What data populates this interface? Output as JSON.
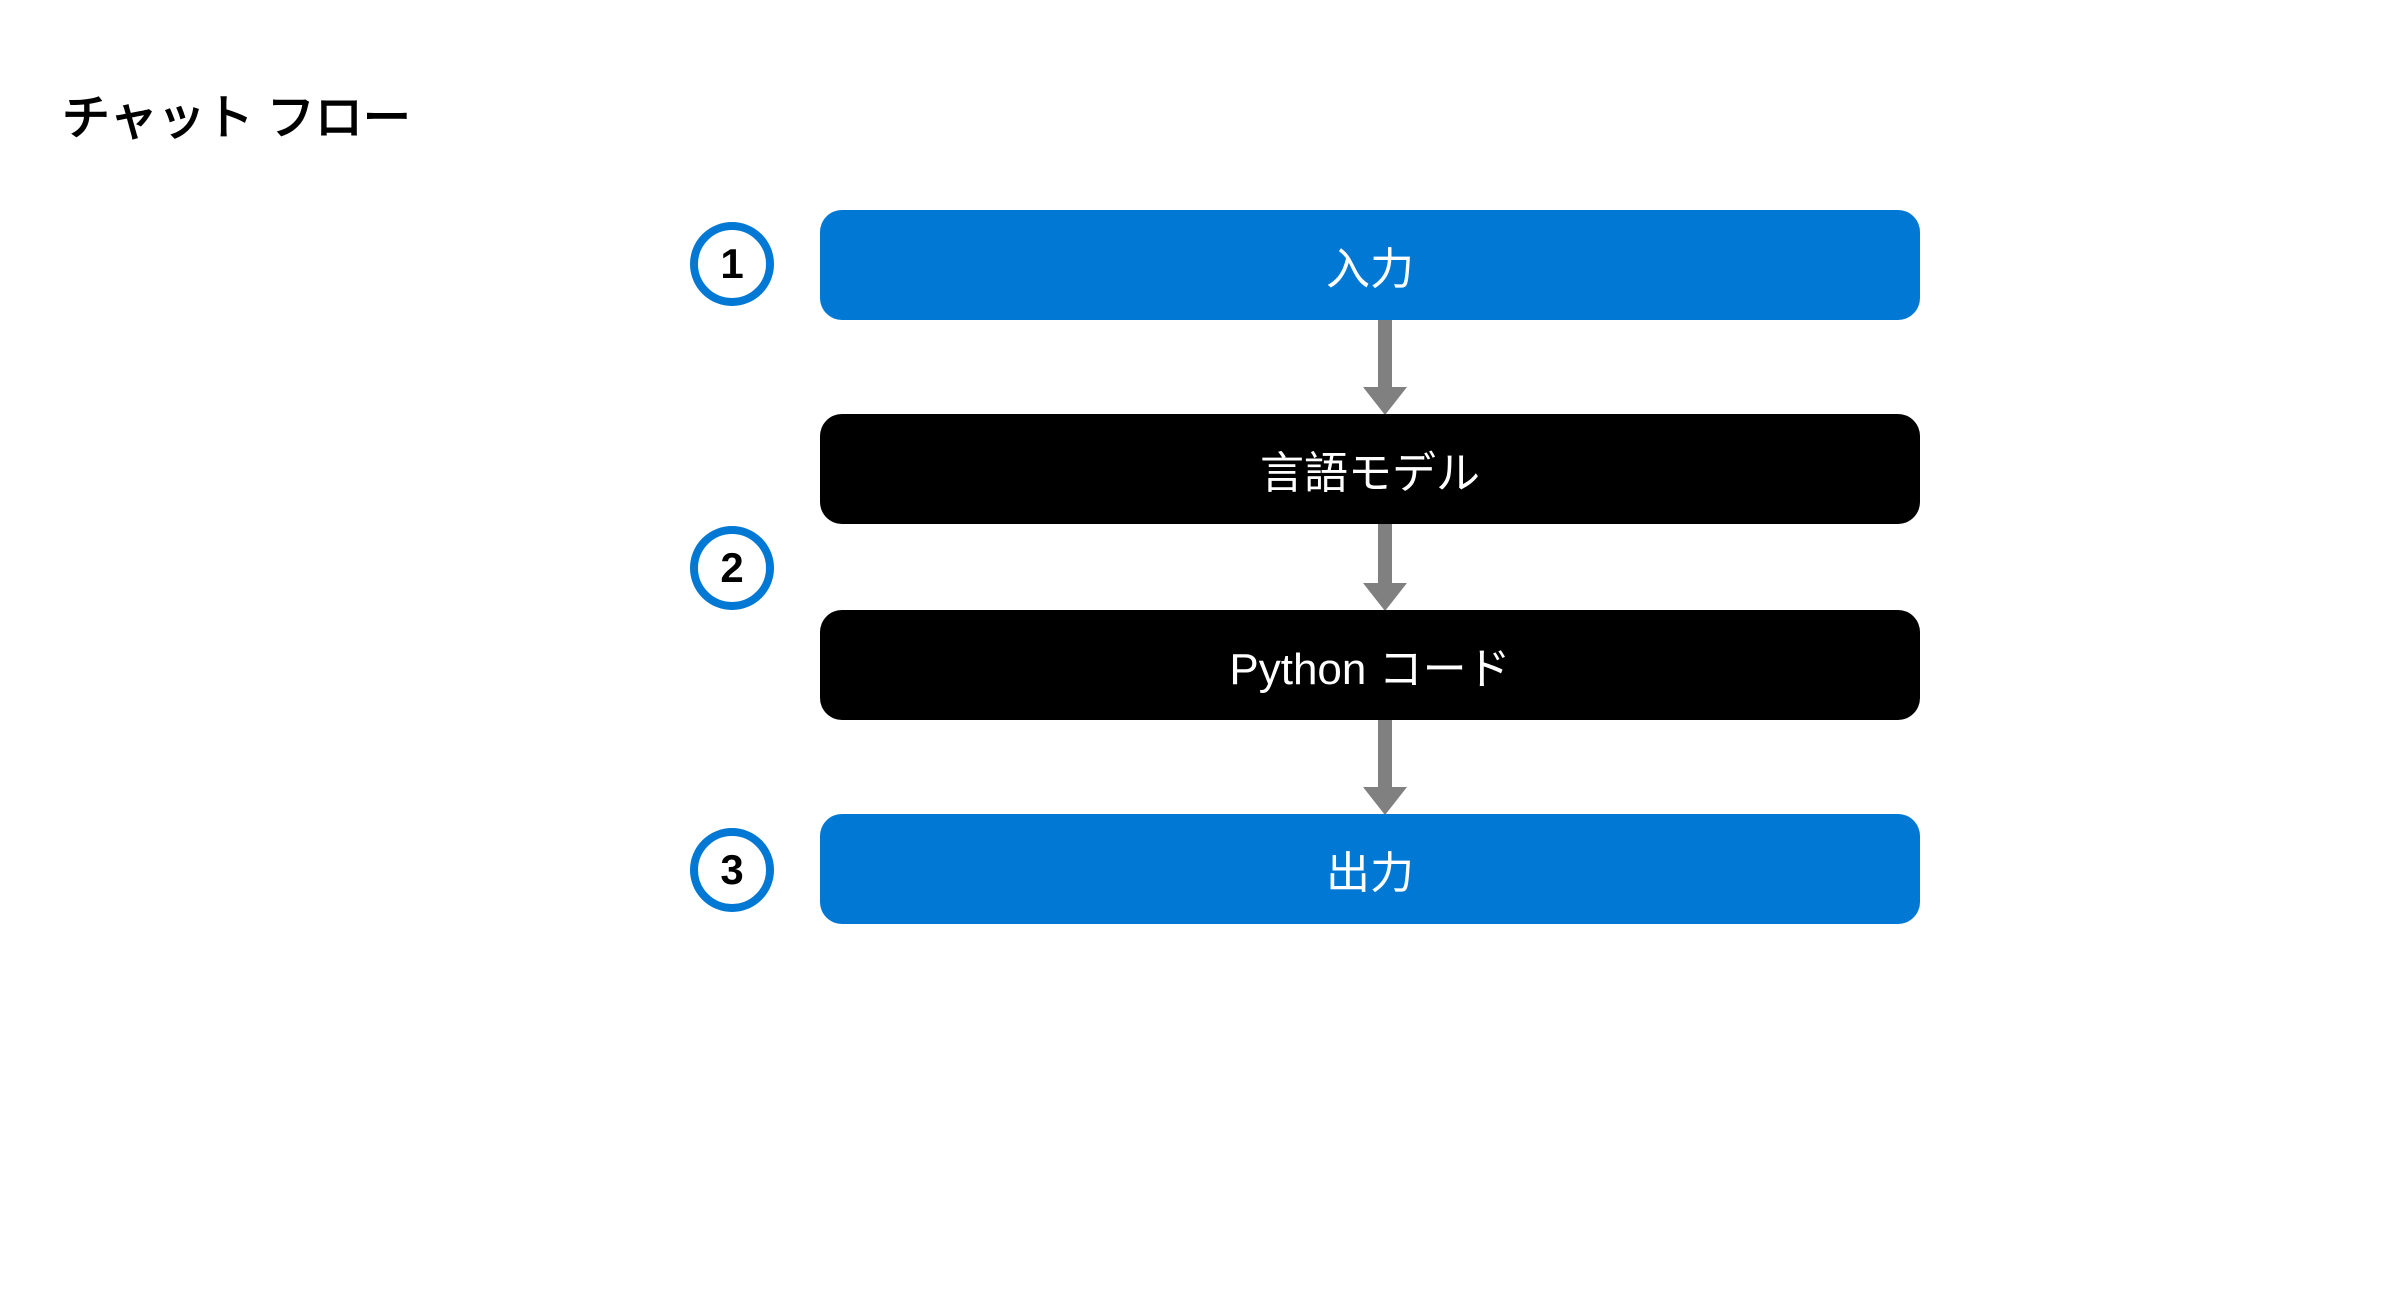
{
  "title": "チャット フロー",
  "steps": {
    "badge1": "1",
    "badge2": "2",
    "badge3": "3"
  },
  "nodes": {
    "input": "入力",
    "language_model": "言語モデル",
    "python_code": "Python コード",
    "output": "出力"
  },
  "colors": {
    "blue": "#0078d4",
    "black": "#000000",
    "arrow": "#808080"
  }
}
